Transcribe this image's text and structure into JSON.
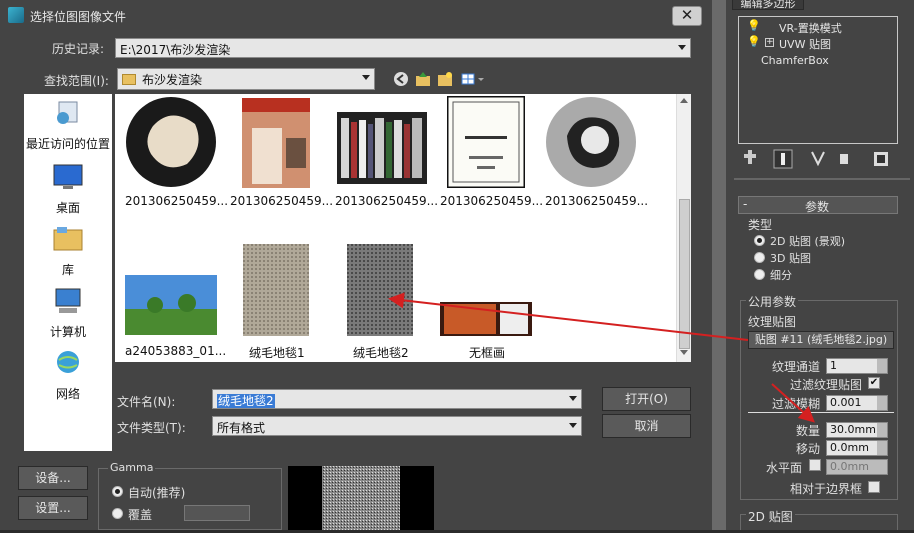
{
  "dialog": {
    "title": "选择位图图像文件",
    "close_label": "✕",
    "history_label": "历史记录:",
    "history_value": "E:\\2017\\布沙发渲染",
    "lookin_label": "查找范围(I):",
    "lookin_value": "布沙发渲染",
    "filename_label": "文件名(N):",
    "filename_value": "绒毛地毯2",
    "filetype_label": "文件类型(T):",
    "filetype_value": "所有格式",
    "open_button": "打开(O)",
    "cancel_button": "取消",
    "setup_button1": "设备...",
    "setup_button2": "设置...",
    "gamma_label": "Gamma",
    "gamma_auto": "自动(推荐)",
    "gamma_override": "覆盖"
  },
  "places": [
    {
      "label": "最近访问的位置",
      "icon": "recent-places-icon"
    },
    {
      "label": "桌面",
      "icon": "desktop-icon"
    },
    {
      "label": "库",
      "icon": "library-icon"
    },
    {
      "label": "计算机",
      "icon": "computer-icon"
    },
    {
      "label": "网络",
      "icon": "network-icon"
    }
  ],
  "files": [
    {
      "name": "201306250459...",
      "icon": "fur-mask-thumbnail"
    },
    {
      "name": "201306250459...",
      "icon": "magazine-thumbnail"
    },
    {
      "name": "201306250459...",
      "icon": "books-thumbnail"
    },
    {
      "name": "201306250459...",
      "icon": "wine-label-thumbnail"
    },
    {
      "name": "201306250459...",
      "icon": "gray-mask-thumbnail"
    },
    {
      "name": "a24053883_01...",
      "icon": "garden-thumbnail"
    },
    {
      "name": "绒毛地毯1",
      "icon": "carpet1-thumbnail"
    },
    {
      "name": "绒毛地毯2",
      "icon": "carpet2-thumbnail"
    },
    {
      "name": "无框画",
      "icon": "painting-thumbnail"
    }
  ],
  "right_panel": {
    "top_button": "编辑多边形",
    "stack": [
      {
        "label": "VR-置换模式",
        "icon": "bulb-icon"
      },
      {
        "label": "UVW 贴图",
        "icon": "bulb-icon"
      },
      {
        "label": "ChamferBox",
        "icon": ""
      }
    ],
    "params_header": "参数",
    "type_label": "类型",
    "type_options": [
      "2D 贴图 (景观)",
      "3D 贴图",
      "细分"
    ],
    "common_label": "公用参数",
    "texture_map_label": "纹理贴图",
    "map_button": "贴图 #11 (绒毛地毯2.jpg)",
    "texture_channel_label": "纹理通道",
    "texture_channel_value": "1",
    "filter_texture_label": "过滤纹理贴图",
    "filter_blur_label": "过滤模糊",
    "filter_blur_value": "0.001",
    "amount_label": "数量",
    "amount_value": "30.0mm",
    "shift_label": "移动",
    "shift_value": "0.0mm",
    "water_level_label": "水平面",
    "water_level_value": "0.0mm",
    "relative_bbox_label": "相对于边界框",
    "map2d_header": "2D 贴图"
  },
  "colors": {
    "arrow": "#d42020",
    "selection": "#3a7bd5",
    "dialog_bg": "#444444"
  }
}
